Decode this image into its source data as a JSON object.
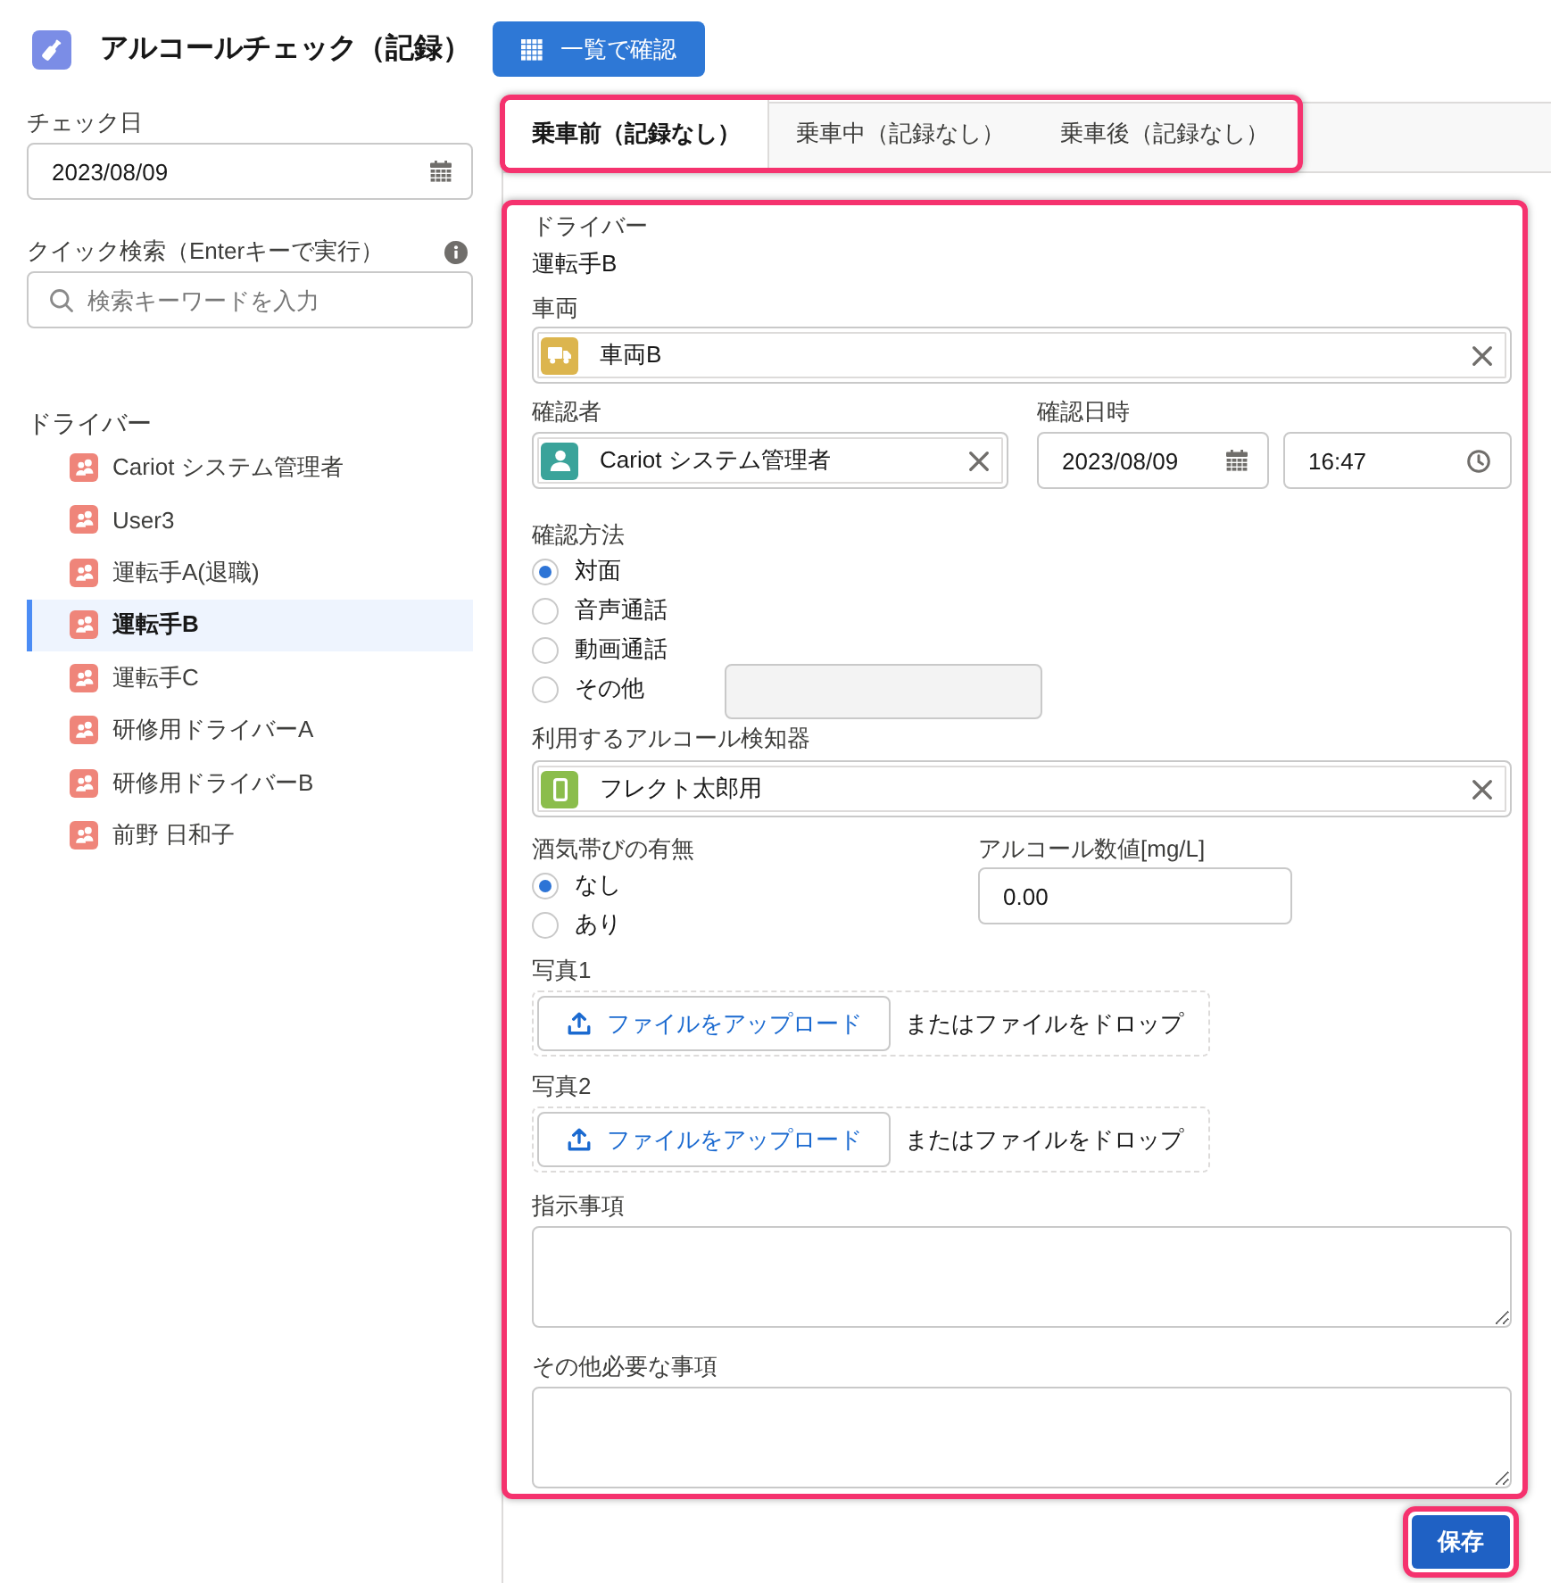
{
  "header": {
    "title": "アルコールチェック（記録）",
    "list_button": "一覧で確認"
  },
  "sidebar": {
    "date_label": "チェック日",
    "date_value": "2023/08/09",
    "search_label": "クイック検索（Enterキーで実行）",
    "search_placeholder": "検索キーワードを入力",
    "drivers_heading": "ドライバー",
    "drivers": [
      {
        "name": "Cariot システム管理者",
        "selected": false
      },
      {
        "name": "User3",
        "selected": false
      },
      {
        "name": "運転手A(退職)",
        "selected": false
      },
      {
        "name": "運転手B",
        "selected": true
      },
      {
        "name": "運転手C",
        "selected": false
      },
      {
        "name": "研修用ドライバーA",
        "selected": false
      },
      {
        "name": "研修用ドライバーB",
        "selected": false
      },
      {
        "name": "前野 日和子",
        "selected": false
      }
    ]
  },
  "tabs": [
    {
      "label": "乗車前（記録なし）",
      "selected": true
    },
    {
      "label": "乗車中（記録なし）",
      "selected": false
    },
    {
      "label": "乗車後（記録なし）",
      "selected": false
    }
  ],
  "form": {
    "driver": {
      "label": "ドライバー",
      "value": "運転手B"
    },
    "vehicle": {
      "label": "車両",
      "value": "車両B"
    },
    "confirmer": {
      "label": "確認者",
      "value": "Cariot システム管理者"
    },
    "confirmed_at": {
      "label": "確認日時",
      "date": "2023/08/09",
      "time": "16:47"
    },
    "method": {
      "label": "確認方法",
      "options": [
        {
          "label": "対面",
          "selected": true
        },
        {
          "label": "音声通話",
          "selected": false
        },
        {
          "label": "動画通話",
          "selected": false
        },
        {
          "label": "その他",
          "selected": false
        }
      ],
      "other_field": {
        "disabled": true
      }
    },
    "detector": {
      "label": "利用するアルコール検知器",
      "value": "フレクト太郎用"
    },
    "alcohol_presence": {
      "label": "酒気帯びの有無",
      "options": [
        {
          "label": "なし",
          "selected": true
        },
        {
          "label": "あり",
          "selected": false
        }
      ]
    },
    "alcohol_value": {
      "label": "アルコール数値[mg/L]",
      "value": "0.00"
    },
    "photos": [
      {
        "label": "写真1",
        "button": "ファイルをアップロード",
        "drop_text": "またはファイルをドロップ"
      },
      {
        "label": "写真2",
        "button": "ファイルをアップロード",
        "drop_text": "またはファイルをドロップ"
      }
    ],
    "notes": [
      {
        "label": "指示事項"
      },
      {
        "label": "その他必要な事項"
      }
    ]
  },
  "save_button": "保存"
}
